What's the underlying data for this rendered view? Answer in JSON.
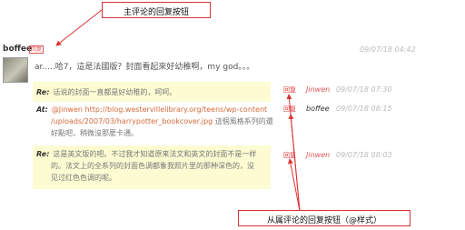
{
  "callouts": {
    "top": "主评论的回复按钮",
    "bottom": "从属评论的回复按钮（@样式）"
  },
  "main_comment": {
    "author": "boffee",
    "reply_label": "回复",
    "date": "09/07/18 04:42",
    "text": "ar.....哈7，這是法國版？封面看起來好幼稚啊，my god。。。"
  },
  "replies": [
    {
      "label": "Re:",
      "text": "话说的封面一直都是好幼稚的，呵呵。",
      "reply_label": "回复",
      "author": "Jinwen",
      "date": "09/07/18 07:30"
    },
    {
      "label": "At:",
      "prefix": "@Jinwen",
      "link": "http://blog.westervillelibrary.org/teens/wp-content/uploads/2007/03/harrypotter_bookcover.jpg",
      "link_line1": "http://blog.westervillelibrary.org/teens/wp-content",
      "link_line2": "/uploads/2007/03/harrypotter_bookcover.jpg",
      "text_after": "這個風格系列的還",
      "text_line3": "好點吧，稍微沒那麼卡通。",
      "reply_label": "回复",
      "author": "boffee",
      "date": "09/07/18 08:15"
    },
    {
      "label": "Re:",
      "text_line1": "这是英文版的吧。不过我才知道原来法文和英文的封面不是一样",
      "text_line2": "的。法文上的全系列的封面色调都象我照片里的那种深色的，没",
      "text_line3": "见过红色色调的呢。",
      "reply_label": "回复",
      "author": "Jinwen",
      "date": "09/07/18 08:03"
    }
  ],
  "colors": {
    "accent": "#d33333",
    "highlight_bg": "#fdfbd2",
    "link": "#d46a3a"
  }
}
